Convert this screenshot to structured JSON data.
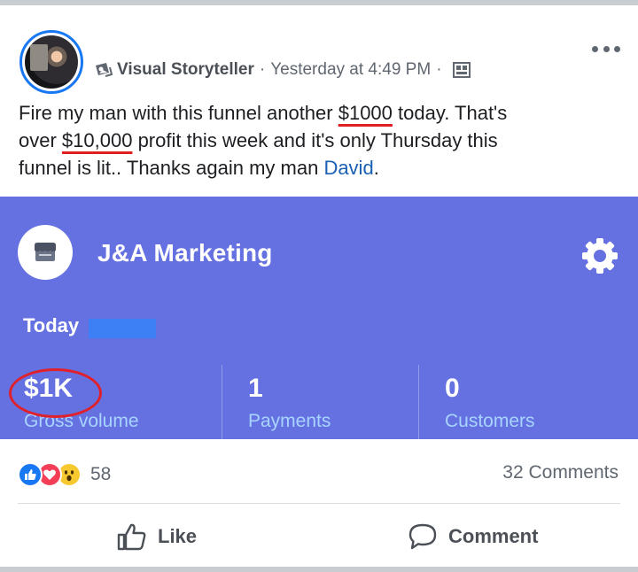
{
  "post": {
    "page_name": "Visual Storyteller",
    "separator": "·",
    "timestamp": "Yesterday at 4:49 PM",
    "text_line1_pre": "Fire my man with this funnel another ",
    "text_line1_amount": "$1000",
    "text_line1_post": " today. That's",
    "text_line2_pre": "over ",
    "text_line2_amount": "$10,000",
    "text_line2_post": " profit this week and it's only Thursday this",
    "text_line3_pre": "funnel is lit.. Thanks again my man ",
    "text_line3_mention": "David",
    "text_line3_post": "."
  },
  "card": {
    "business_name": "J&A Marketing",
    "period_label": "Today",
    "stats": [
      {
        "value": "$1K",
        "label": "Gross volume"
      },
      {
        "value": "1",
        "label": "Payments"
      },
      {
        "value": "0",
        "label": "Customers"
      }
    ],
    "bg_color": "#6571e0",
    "label_color": "#a8d4ff"
  },
  "engagement": {
    "reaction_count": "58",
    "comments": "32 Comments"
  },
  "actions": {
    "like_label": "Like",
    "comment_label": "Comment"
  },
  "icons": [
    "more-icon",
    "page-icon",
    "audience-icon",
    "store-icon",
    "gear-icon",
    "like-reaction-icon",
    "love-reaction-icon",
    "wow-reaction-icon",
    "thumbs-up-icon",
    "comment-icon"
  ]
}
